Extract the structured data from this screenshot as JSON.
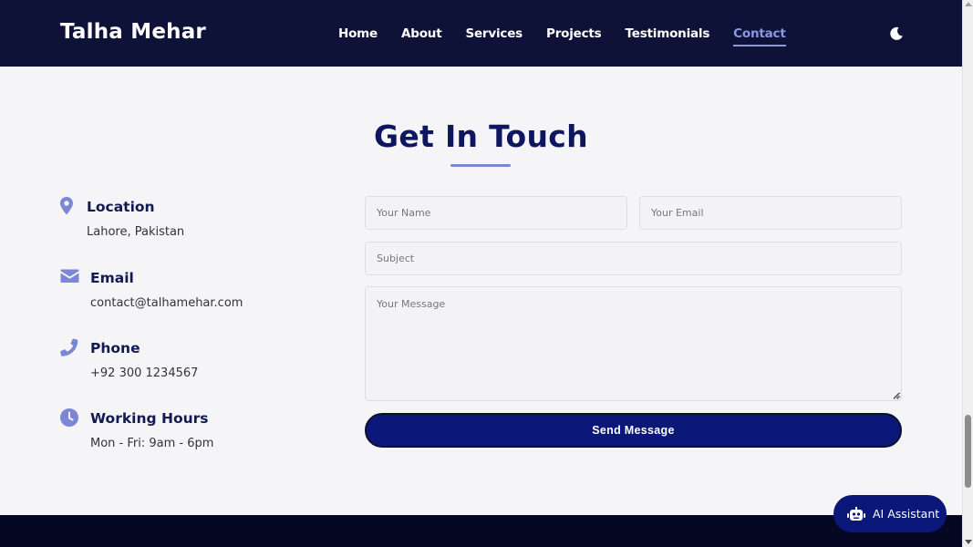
{
  "brand": "Talha Mehar",
  "nav": [
    {
      "label": "Home",
      "active": false
    },
    {
      "label": "About",
      "active": false
    },
    {
      "label": "Services",
      "active": false
    },
    {
      "label": "Projects",
      "active": false
    },
    {
      "label": "Testimonials",
      "active": false
    },
    {
      "label": "Contact",
      "active": true
    }
  ],
  "theme_toggle_icon": "moon-icon",
  "section": {
    "title": "Get In Touch"
  },
  "contact_info": [
    {
      "icon": "location-pin-icon",
      "title": "Location",
      "text": "Lahore, Pakistan"
    },
    {
      "icon": "envelope-icon",
      "title": "Email",
      "text": "contact@talhamehar.com"
    },
    {
      "icon": "phone-icon",
      "title": "Phone",
      "text": "+92 300 1234567"
    },
    {
      "icon": "clock-icon",
      "title": "Working Hours",
      "text": "Mon - Fri: 9am - 6pm"
    }
  ],
  "form": {
    "name_placeholder": "Your Name",
    "email_placeholder": "Your Email",
    "subject_placeholder": "Subject",
    "message_placeholder": "Your Message",
    "submit_label": "Send Message"
  },
  "assistant": {
    "label": "AI Assistant",
    "icon": "robot-icon"
  },
  "colors": {
    "header_bg": "#0e1238",
    "accent": "#8b97e0",
    "primary_button": "#0c177a",
    "title": "#0f1660",
    "footer_bg": "#050822"
  }
}
